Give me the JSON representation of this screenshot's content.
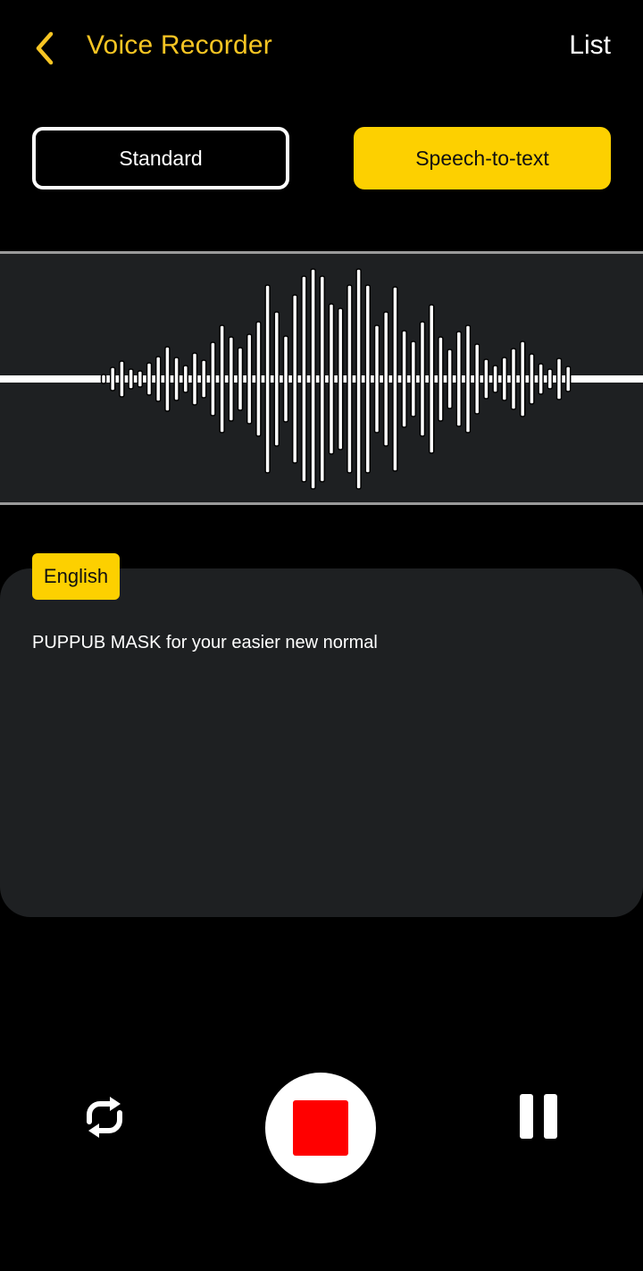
{
  "header": {
    "back_icon": "chevron-left-icon",
    "title": "Voice Recorder",
    "list_label": "List"
  },
  "modes": {
    "standard_label": "Standard",
    "speech_label": "Speech-to-text",
    "selected": "Speech-to-text"
  },
  "waveform": {
    "icon": "waveform-visualizer"
  },
  "transcript": {
    "language": "English",
    "text": "PUPPUB MASK for your easier new normal"
  },
  "controls": {
    "replay_icon": "replay-icon",
    "stop_icon": "stop-icon",
    "pause_icon": "pause-icon"
  },
  "colors": {
    "accent": "#fdd000",
    "title": "#f7c523",
    "background": "#000000",
    "panel": "#1e2022",
    "stop": "#ff0000"
  }
}
